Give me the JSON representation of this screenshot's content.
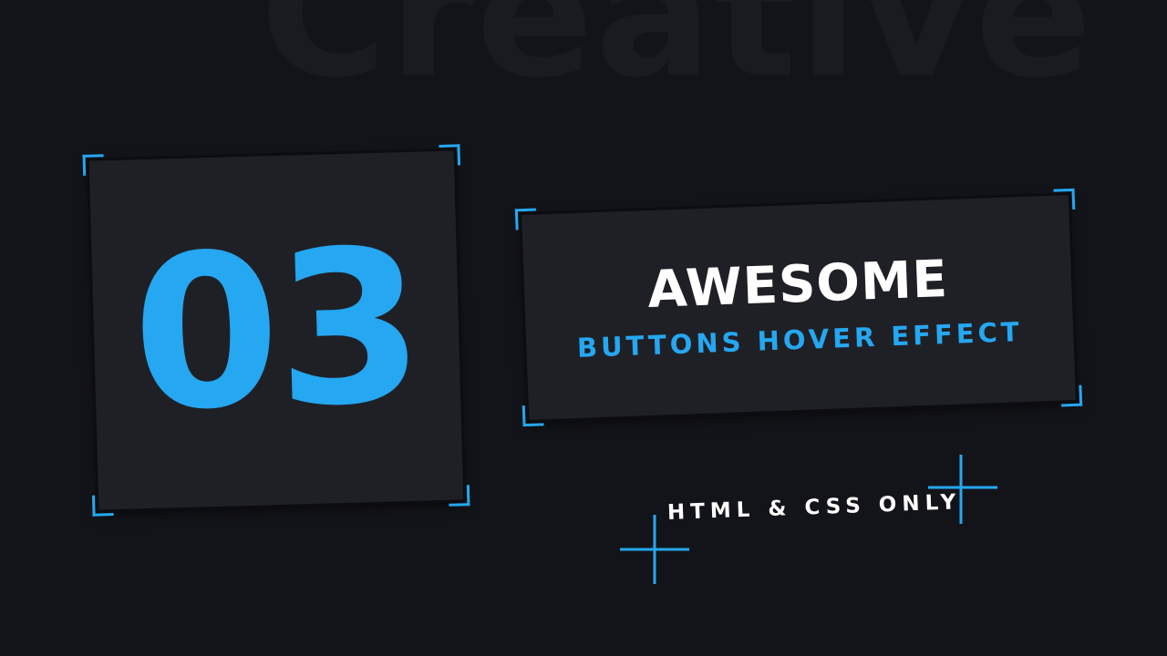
{
  "background": {
    "word": "Creative",
    "color": "#131419",
    "word_color": "#1a1b20"
  },
  "episode": {
    "number": "03"
  },
  "title": {
    "main": "AWESOME",
    "sub": "BUTTONS HOVER EFFECT"
  },
  "tagline": "HTML & CSS ONLY",
  "colors": {
    "accent": "#25a7f1",
    "card": "#1f2026",
    "text": "#ffffff"
  },
  "icons": [
    "corner-bracket-icon",
    "plus-icon"
  ]
}
